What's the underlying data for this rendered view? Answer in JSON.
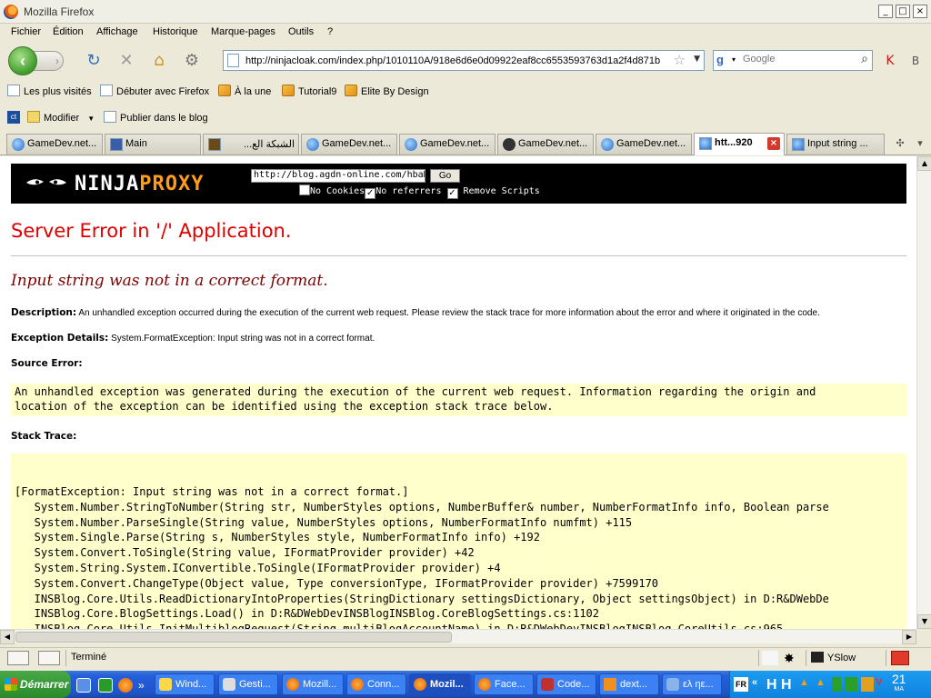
{
  "window": {
    "title": "Mozilla Firefox",
    "controls": [
      "_",
      "□",
      "×"
    ]
  },
  "menu": [
    "Fichier",
    "Édition",
    "Affichage",
    "Historique",
    "Marque-pages",
    "Outils",
    "?"
  ],
  "nav": {
    "url": "http://ninjacloak.com/index.php/1010110A/918e6d6e0d09922eaf8cc6553593763d1a2f4d871b",
    "search_placeholder": "Google"
  },
  "bookmarks": [
    "Les plus visités",
    "Débuter avec Firefox",
    "À la une",
    "Tutorial9",
    "Elite By Design"
  ],
  "toolbar2": {
    "edit_label": "Modifier",
    "publish_label": "Publier dans le blog"
  },
  "tabs": [
    {
      "label": "GameDev.net..."
    },
    {
      "label": "Main"
    },
    {
      "label": "الشبكة الع..."
    },
    {
      "label": "GameDev.net..."
    },
    {
      "label": "GameDev.net..."
    },
    {
      "label": "GameDev.net..."
    },
    {
      "label": "GameDev.net..."
    },
    {
      "label": "htt...920"
    },
    {
      "label": "Input string ..."
    }
  ],
  "proxy": {
    "logo_left": "NINJA",
    "logo_right": "PROXY",
    "url_value": "http://blog.agdn-online.com/hbaH",
    "go_label": "Go",
    "opt_no_cookies": "No Cookies",
    "opt_no_referrers": "No referrers",
    "opt_remove_scripts": "Remove Scripts",
    "opt_checked": [
      "",
      "✓",
      "✓"
    ]
  },
  "error": {
    "title": "Server Error in '/' Application.",
    "subtitle": "Input string was not in a correct format.",
    "description_label": "Description:",
    "description": "An unhandled exception occurred during the execution of the current web request. Please review the stack trace for more information about the error and where it originated in the code.",
    "exception_label": "Exception Details:",
    "exception": "System.FormatException: Input string was not in a correct format.",
    "source_label": "Source Error:",
    "source_text": "An unhandled exception was generated during the execution of the current web request. Information regarding the origin and\nlocation of the exception can be identified using the exception stack trace below.",
    "stack_label": "Stack Trace:",
    "stack_text": "[FormatException: Input string was not in a correct format.]\n   System.Number.StringToNumber(String str, NumberStyles options, NumberBuffer& number, NumberFormatInfo info, Boolean parse\n   System.Number.ParseSingle(String value, NumberStyles options, NumberFormatInfo numfmt) +115\n   System.Single.Parse(String s, NumberStyles style, NumberFormatInfo info) +192\n   System.Convert.ToSingle(String value, IFormatProvider provider) +42\n   System.String.System.IConvertible.ToSingle(IFormatProvider provider) +4\n   System.Convert.ChangeType(Object value, Type conversionType, IFormatProvider provider) +7599170\n   INSBlog.Core.Utils.ReadDictionaryIntoProperties(StringDictionary settingsDictionary, Object settingsObject) in D:R&DWebDe\n   INSBlog.Core.BlogSettings.Load() in D:R&DWebDevINSBlogINSBlog.CoreBlogSettings.cs:1102\n   INSBlog.Core.Utils.InitMultiblogRequest(String multiBlogAccountName) in D:R&DWebDevINSBlogINSBlog.CoreUtils.cs:965"
  },
  "status": {
    "text": "Terminé",
    "yslow": "YSlow"
  },
  "taskbar": {
    "start": "Démarrer",
    "tasks": [
      "Wind...",
      "Gesti...",
      "Mozill...",
      "Conn...",
      "Mozil...",
      "Face...",
      "Code...",
      "dext...",
      "ελ ηε..."
    ],
    "tray_lang": "FR",
    "clock_time": "21",
    "clock_sub": "MA"
  },
  "colors": {
    "error_red": "#e00000",
    "error_dark": "#800000",
    "code_bg": "#ffffcc",
    "proxy_orange": "#ff9d1a"
  }
}
